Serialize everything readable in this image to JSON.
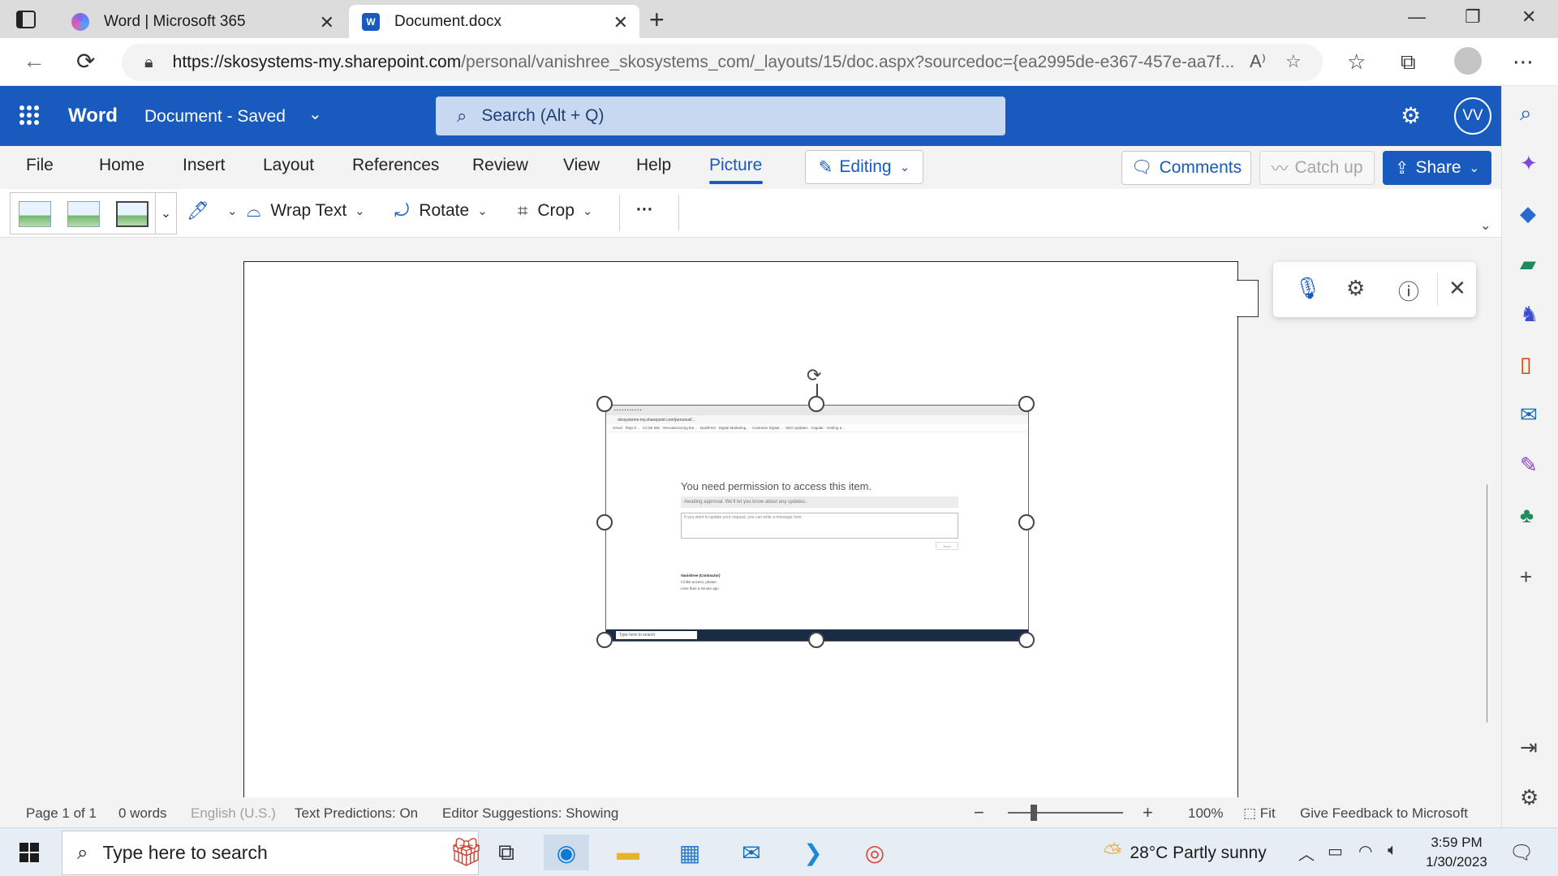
{
  "browser": {
    "tabs": [
      {
        "title": "Word | Microsoft 365",
        "active": false
      },
      {
        "title": "Document.docx",
        "active": true
      }
    ],
    "url_host": "https://skosystems-my.sharepoint.com",
    "url_path": "/personal/vanishree_skosystems_com/_layouts/15/doc.aspx?sourcedoc={ea2995de-e367-457e-aa7f..."
  },
  "word": {
    "app_name": "Word",
    "doc_name": "Document",
    "separator": "-",
    "save_status": "Saved",
    "search_placeholder": "Search (Alt + Q)",
    "user_initials": "VV"
  },
  "ribbon": {
    "tabs": [
      "File",
      "Home",
      "Insert",
      "Layout",
      "References",
      "Review",
      "View",
      "Help",
      "Picture"
    ],
    "active_tab": "Picture",
    "mode_button": "Editing",
    "comments": "Comments",
    "catch_up": "Catch up",
    "share": "Share",
    "commands": {
      "wrap_text": "Wrap Text",
      "rotate": "Rotate",
      "crop": "Crop",
      "more": "···"
    }
  },
  "picture_content": {
    "heading": "You need permission to access this item.",
    "banner": "Awaiting approval. We'll let you know about any updates.",
    "textarea_placeholder": "If you want to update your request, you can write a message here",
    "send": "Send",
    "user_name": "Vanishree (Contractor)",
    "user_note": "I'd like access, please.",
    "user_time": "Less than a minute ago",
    "taskbar_search": "Type here to search"
  },
  "statusbar": {
    "page": "Page 1 of 1",
    "words": "0 words",
    "language": "English (U.S.)",
    "predictions": "Text Predictions: On",
    "editor": "Editor Suggestions: Showing",
    "zoom": "100%",
    "fit": "Fit",
    "feedback": "Give Feedback to Microsoft"
  },
  "taskbar": {
    "search_placeholder": "Type here to search",
    "weather": "28°C  Partly sunny",
    "time": "3:59 PM",
    "date": "1/30/2023"
  }
}
